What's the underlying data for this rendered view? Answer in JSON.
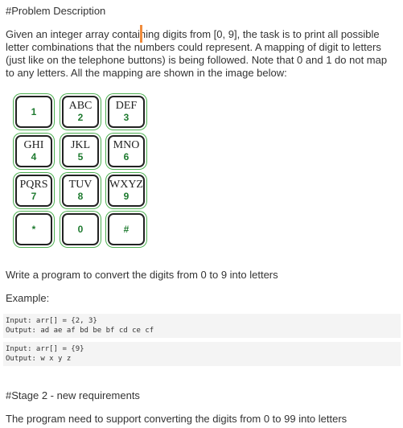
{
  "problem": {
    "section_title": "#Problem Description",
    "description": "Given an integer array containing digits from [0, 9], the task is to print all possible letter combinations that the numbers could represent. A mapping of digit to letters (just like on the telephone buttons) is being followed. Note that 0 and 1 do not map to any letters. All the mapping are shown in the image below:"
  },
  "keypad": {
    "keys": [
      {
        "digit": "1",
        "letters": ""
      },
      {
        "digit": "2",
        "letters": "ABC"
      },
      {
        "digit": "3",
        "letters": "DEF"
      },
      {
        "digit": "4",
        "letters": "GHI"
      },
      {
        "digit": "5",
        "letters": "JKL"
      },
      {
        "digit": "6",
        "letters": "MNO"
      },
      {
        "digit": "7",
        "letters": "PQRS"
      },
      {
        "digit": "8",
        "letters": "TUV"
      },
      {
        "digit": "9",
        "letters": "WXYZ"
      },
      {
        "digit": "*",
        "letters": ""
      },
      {
        "digit": "0",
        "letters": ""
      },
      {
        "digit": "#",
        "letters": ""
      }
    ]
  },
  "task": "Write a program to convert the digits from 0 to 9 into letters",
  "example_label": "Example:",
  "examples": [
    {
      "input": "Input: arr[] = {2, 3}",
      "output": "Output: ad ae af bd be bf cd ce cf"
    },
    {
      "input": "Input: arr[] = {9}",
      "output": "Output: w x y z"
    }
  ],
  "stage2": {
    "title": "#Stage 2 - new requirements",
    "text": "The program need to support converting the digits from 0 to 99 into letters"
  },
  "colors": {
    "caret": "#f08c3c",
    "key_outline": "#4caf50",
    "digit": "#1e7a2f"
  }
}
